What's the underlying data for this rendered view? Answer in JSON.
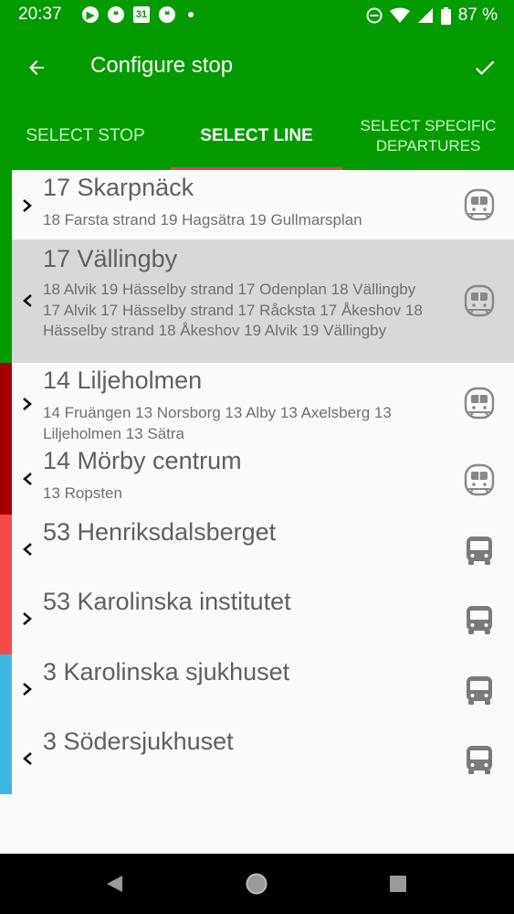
{
  "status_bar": {
    "time": "20:37",
    "calendar_day": "31",
    "battery": "87 %"
  },
  "app_bar": {
    "title": "Configure stop"
  },
  "tabs": [
    {
      "label": "SELECT STOP"
    },
    {
      "label": "SELECT LINE"
    },
    {
      "label": "SELECT SPECIFIC DEPARTURES"
    }
  ],
  "lines": [
    {
      "title": "17 Skarpnäck",
      "subtitle": "18 Farsta strand 19 Hagsätra 19 Gullmarsplan",
      "icon": "metro-icon",
      "chevron": "right"
    },
    {
      "title": "17 Vällingby",
      "subtitle": "18 Alvik 19 Hässelby strand 17 Odenplan 18 Vällingby 17 Alvik 17 Hässelby strand 17 Råcksta 17 Åkeshov 18 Hässelby strand 18 Åkeshov 19 Alvik 19 Vällingby",
      "icon": "metro-icon",
      "chevron": "left"
    },
    {
      "title": "14 Liljeholmen",
      "subtitle": "14 Fruängen 13 Norsborg 13 Alby 13 Axelsberg 13 Liljeholmen 13 Sätra",
      "icon": "metro-icon",
      "chevron": "right"
    },
    {
      "title": "14 Mörby centrum",
      "subtitle": "13 Ropsten",
      "icon": "metro-icon",
      "chevron": "left"
    },
    {
      "title": "53 Henriksdalsberget",
      "subtitle": "",
      "icon": "bus-icon",
      "chevron": "left"
    },
    {
      "title": "53 Karolinska institutet",
      "subtitle": "",
      "icon": "bus-icon",
      "chevron": "right"
    },
    {
      "title": "3 Karolinska sjukhuset",
      "subtitle": "",
      "icon": "bus-icon",
      "chevron": "right"
    },
    {
      "title": "3 Södersjukhuset",
      "subtitle": "",
      "icon": "bus-icon",
      "chevron": "left"
    }
  ],
  "colors": {
    "brand_green": "#049b00",
    "tab_indicator": "#e7425f",
    "green_line": "#049b00",
    "red_line": "#a50000",
    "bus_red": "#f24a4a",
    "bus_blue": "#3db6e6"
  }
}
